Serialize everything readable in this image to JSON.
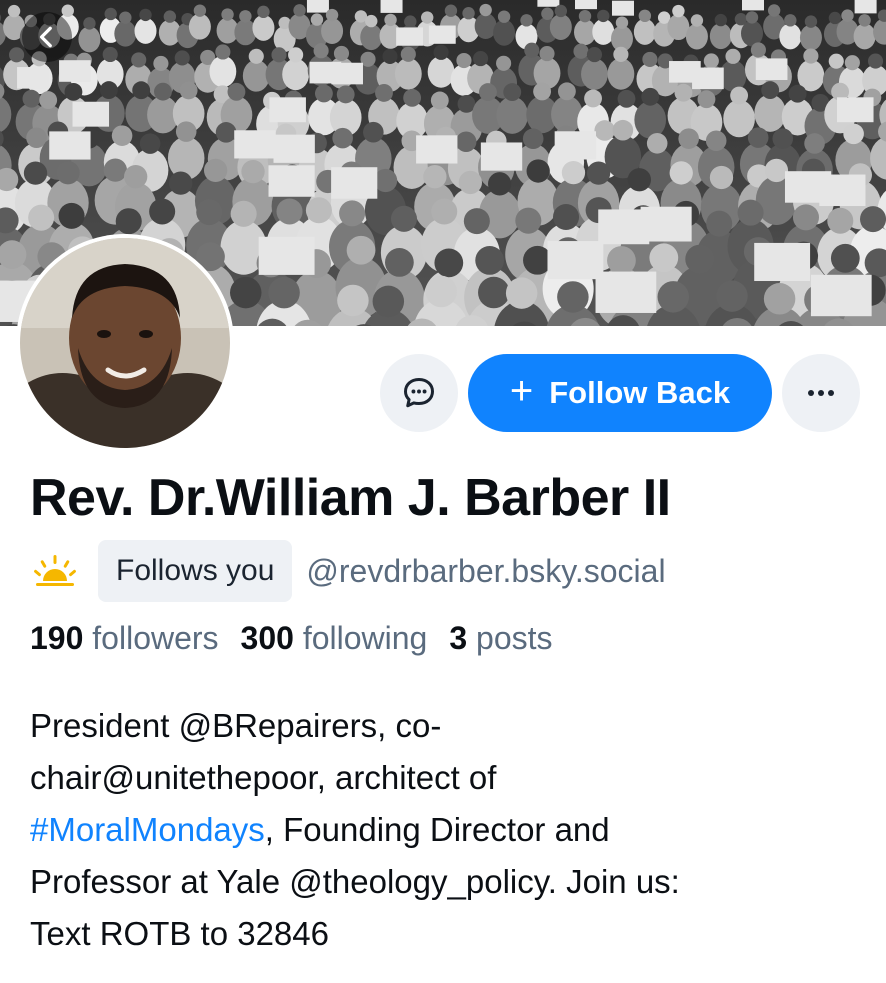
{
  "profile": {
    "display_name": "Rev. Dr.William J. Barber II",
    "follows_you": "Follows you",
    "handle": "@revdrbarber.bsky.social",
    "stats": {
      "followers_count": "190",
      "followers_label": "followers",
      "following_count": "300",
      "following_label": "following",
      "posts_count": "3",
      "posts_label": "posts"
    },
    "bio": {
      "line1": "President @BRepairers, co-",
      "line2": "chair@unitethepoor, architect of",
      "line3_tag": "#MoralMondays",
      "line3_rest": ", Founding Director and",
      "line4": "Professor at Yale @theology_policy. Join us:",
      "line5": "Text ROTB to 32846"
    }
  },
  "actions": {
    "follow_plus": "+",
    "follow_label": "Follow Back"
  },
  "icons": {
    "back": "chevron-left-icon",
    "message": "chat-bubble-icon",
    "more": "ellipsis-icon",
    "badge": "sun-icon"
  },
  "colors": {
    "accent": "#1083fe",
    "muted_text": "#5a6b7e",
    "pill_bg": "#eef1f5",
    "sun": "#f5b700"
  }
}
